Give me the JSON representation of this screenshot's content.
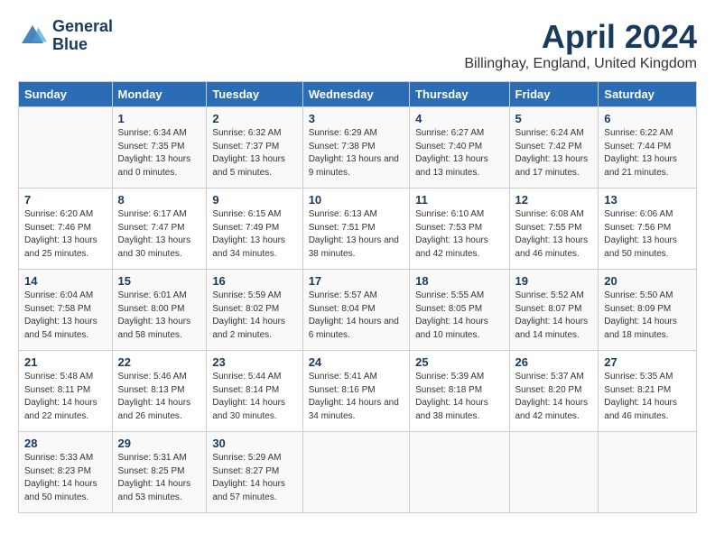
{
  "logo": {
    "line1": "General",
    "line2": "Blue"
  },
  "title": "April 2024",
  "location": "Billinghay, England, United Kingdom",
  "weekdays": [
    "Sunday",
    "Monday",
    "Tuesday",
    "Wednesday",
    "Thursday",
    "Friday",
    "Saturday"
  ],
  "weeks": [
    [
      {
        "day": "",
        "sunrise": "",
        "sunset": "",
        "daylight": ""
      },
      {
        "day": "1",
        "sunrise": "Sunrise: 6:34 AM",
        "sunset": "Sunset: 7:35 PM",
        "daylight": "Daylight: 13 hours and 0 minutes."
      },
      {
        "day": "2",
        "sunrise": "Sunrise: 6:32 AM",
        "sunset": "Sunset: 7:37 PM",
        "daylight": "Daylight: 13 hours and 5 minutes."
      },
      {
        "day": "3",
        "sunrise": "Sunrise: 6:29 AM",
        "sunset": "Sunset: 7:38 PM",
        "daylight": "Daylight: 13 hours and 9 minutes."
      },
      {
        "day": "4",
        "sunrise": "Sunrise: 6:27 AM",
        "sunset": "Sunset: 7:40 PM",
        "daylight": "Daylight: 13 hours and 13 minutes."
      },
      {
        "day": "5",
        "sunrise": "Sunrise: 6:24 AM",
        "sunset": "Sunset: 7:42 PM",
        "daylight": "Daylight: 13 hours and 17 minutes."
      },
      {
        "day": "6",
        "sunrise": "Sunrise: 6:22 AM",
        "sunset": "Sunset: 7:44 PM",
        "daylight": "Daylight: 13 hours and 21 minutes."
      }
    ],
    [
      {
        "day": "7",
        "sunrise": "Sunrise: 6:20 AM",
        "sunset": "Sunset: 7:46 PM",
        "daylight": "Daylight: 13 hours and 25 minutes."
      },
      {
        "day": "8",
        "sunrise": "Sunrise: 6:17 AM",
        "sunset": "Sunset: 7:47 PM",
        "daylight": "Daylight: 13 hours and 30 minutes."
      },
      {
        "day": "9",
        "sunrise": "Sunrise: 6:15 AM",
        "sunset": "Sunset: 7:49 PM",
        "daylight": "Daylight: 13 hours and 34 minutes."
      },
      {
        "day": "10",
        "sunrise": "Sunrise: 6:13 AM",
        "sunset": "Sunset: 7:51 PM",
        "daylight": "Daylight: 13 hours and 38 minutes."
      },
      {
        "day": "11",
        "sunrise": "Sunrise: 6:10 AM",
        "sunset": "Sunset: 7:53 PM",
        "daylight": "Daylight: 13 hours and 42 minutes."
      },
      {
        "day": "12",
        "sunrise": "Sunrise: 6:08 AM",
        "sunset": "Sunset: 7:55 PM",
        "daylight": "Daylight: 13 hours and 46 minutes."
      },
      {
        "day": "13",
        "sunrise": "Sunrise: 6:06 AM",
        "sunset": "Sunset: 7:56 PM",
        "daylight": "Daylight: 13 hours and 50 minutes."
      }
    ],
    [
      {
        "day": "14",
        "sunrise": "Sunrise: 6:04 AM",
        "sunset": "Sunset: 7:58 PM",
        "daylight": "Daylight: 13 hours and 54 minutes."
      },
      {
        "day": "15",
        "sunrise": "Sunrise: 6:01 AM",
        "sunset": "Sunset: 8:00 PM",
        "daylight": "Daylight: 13 hours and 58 minutes."
      },
      {
        "day": "16",
        "sunrise": "Sunrise: 5:59 AM",
        "sunset": "Sunset: 8:02 PM",
        "daylight": "Daylight: 14 hours and 2 minutes."
      },
      {
        "day": "17",
        "sunrise": "Sunrise: 5:57 AM",
        "sunset": "Sunset: 8:04 PM",
        "daylight": "Daylight: 14 hours and 6 minutes."
      },
      {
        "day": "18",
        "sunrise": "Sunrise: 5:55 AM",
        "sunset": "Sunset: 8:05 PM",
        "daylight": "Daylight: 14 hours and 10 minutes."
      },
      {
        "day": "19",
        "sunrise": "Sunrise: 5:52 AM",
        "sunset": "Sunset: 8:07 PM",
        "daylight": "Daylight: 14 hours and 14 minutes."
      },
      {
        "day": "20",
        "sunrise": "Sunrise: 5:50 AM",
        "sunset": "Sunset: 8:09 PM",
        "daylight": "Daylight: 14 hours and 18 minutes."
      }
    ],
    [
      {
        "day": "21",
        "sunrise": "Sunrise: 5:48 AM",
        "sunset": "Sunset: 8:11 PM",
        "daylight": "Daylight: 14 hours and 22 minutes."
      },
      {
        "day": "22",
        "sunrise": "Sunrise: 5:46 AM",
        "sunset": "Sunset: 8:13 PM",
        "daylight": "Daylight: 14 hours and 26 minutes."
      },
      {
        "day": "23",
        "sunrise": "Sunrise: 5:44 AM",
        "sunset": "Sunset: 8:14 PM",
        "daylight": "Daylight: 14 hours and 30 minutes."
      },
      {
        "day": "24",
        "sunrise": "Sunrise: 5:41 AM",
        "sunset": "Sunset: 8:16 PM",
        "daylight": "Daylight: 14 hours and 34 minutes."
      },
      {
        "day": "25",
        "sunrise": "Sunrise: 5:39 AM",
        "sunset": "Sunset: 8:18 PM",
        "daylight": "Daylight: 14 hours and 38 minutes."
      },
      {
        "day": "26",
        "sunrise": "Sunrise: 5:37 AM",
        "sunset": "Sunset: 8:20 PM",
        "daylight": "Daylight: 14 hours and 42 minutes."
      },
      {
        "day": "27",
        "sunrise": "Sunrise: 5:35 AM",
        "sunset": "Sunset: 8:21 PM",
        "daylight": "Daylight: 14 hours and 46 minutes."
      }
    ],
    [
      {
        "day": "28",
        "sunrise": "Sunrise: 5:33 AM",
        "sunset": "Sunset: 8:23 PM",
        "daylight": "Daylight: 14 hours and 50 minutes."
      },
      {
        "day": "29",
        "sunrise": "Sunrise: 5:31 AM",
        "sunset": "Sunset: 8:25 PM",
        "daylight": "Daylight: 14 hours and 53 minutes."
      },
      {
        "day": "30",
        "sunrise": "Sunrise: 5:29 AM",
        "sunset": "Sunset: 8:27 PM",
        "daylight": "Daylight: 14 hours and 57 minutes."
      },
      {
        "day": "",
        "sunrise": "",
        "sunset": "",
        "daylight": ""
      },
      {
        "day": "",
        "sunrise": "",
        "sunset": "",
        "daylight": ""
      },
      {
        "day": "",
        "sunrise": "",
        "sunset": "",
        "daylight": ""
      },
      {
        "day": "",
        "sunrise": "",
        "sunset": "",
        "daylight": ""
      }
    ]
  ]
}
